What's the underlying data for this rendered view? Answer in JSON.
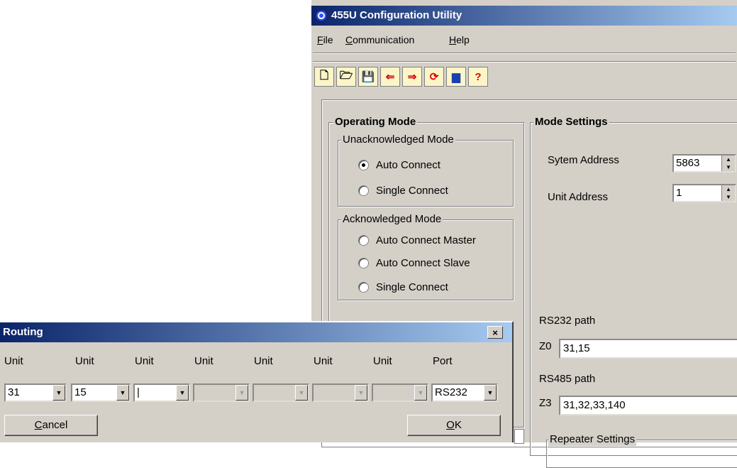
{
  "main_window": {
    "title": "455U Configuration Utility",
    "menu": [
      {
        "label": "File",
        "accel": "F",
        "rest": "ile"
      },
      {
        "label": "Communication",
        "accel": "C",
        "rest": "ommunication"
      },
      {
        "label": "Help",
        "accel": "H",
        "rest": "elp"
      }
    ],
    "toolbar": [
      {
        "icon": "new-file-icon",
        "glyph": "🗋"
      },
      {
        "icon": "open-folder-icon",
        "glyph": "🗁"
      },
      {
        "icon": "save-icon",
        "glyph": "💾"
      },
      {
        "icon": "upload-icon",
        "glyph": "⇐"
      },
      {
        "icon": "download-icon",
        "glyph": "⇒"
      },
      {
        "icon": "reset-icon",
        "glyph": "⟳"
      },
      {
        "icon": "diagnostics-icon",
        "glyph": "▆"
      },
      {
        "icon": "help-icon",
        "glyph": "?"
      }
    ],
    "operating_mode": {
      "title": "Operating Mode",
      "unack_title": "Unacknowledged Mode",
      "unack_options": [
        "Auto Connect",
        "Single Connect"
      ],
      "unack_selected": 0,
      "ack_title": "Acknowledged Mode",
      "ack_options": [
        "Auto Connect Master",
        "Auto Connect Slave",
        "Single Connect"
      ]
    },
    "mode_settings": {
      "title": "Mode Settings",
      "system_address_label": "Sytem Address",
      "system_address_value": "5863",
      "unit_address_label": "Unit Address",
      "unit_address_value": "1",
      "rs232_label": "RS232 path",
      "rs232_prefix": "Z0",
      "rs232_value": "31,15",
      "rs485_label": "RS485 path",
      "rs485_prefix": "Z3",
      "rs485_value": "31,32,33,140",
      "repeater_title": "Repeater Settings"
    }
  },
  "routing": {
    "title": "Routing",
    "close": "×",
    "headers": [
      "Unit",
      "Unit",
      "Unit",
      "Unit",
      "Unit",
      "Unit",
      "Unit",
      "Port"
    ],
    "values": [
      "31",
      "15",
      "|",
      "",
      "",
      "",
      "",
      "RS232"
    ],
    "cancel_label": "Cancel",
    "cancel_accel": "C",
    "cancel_rest": "ancel",
    "ok_label": "OK",
    "ok_accel": "O",
    "ok_rest": "K"
  }
}
